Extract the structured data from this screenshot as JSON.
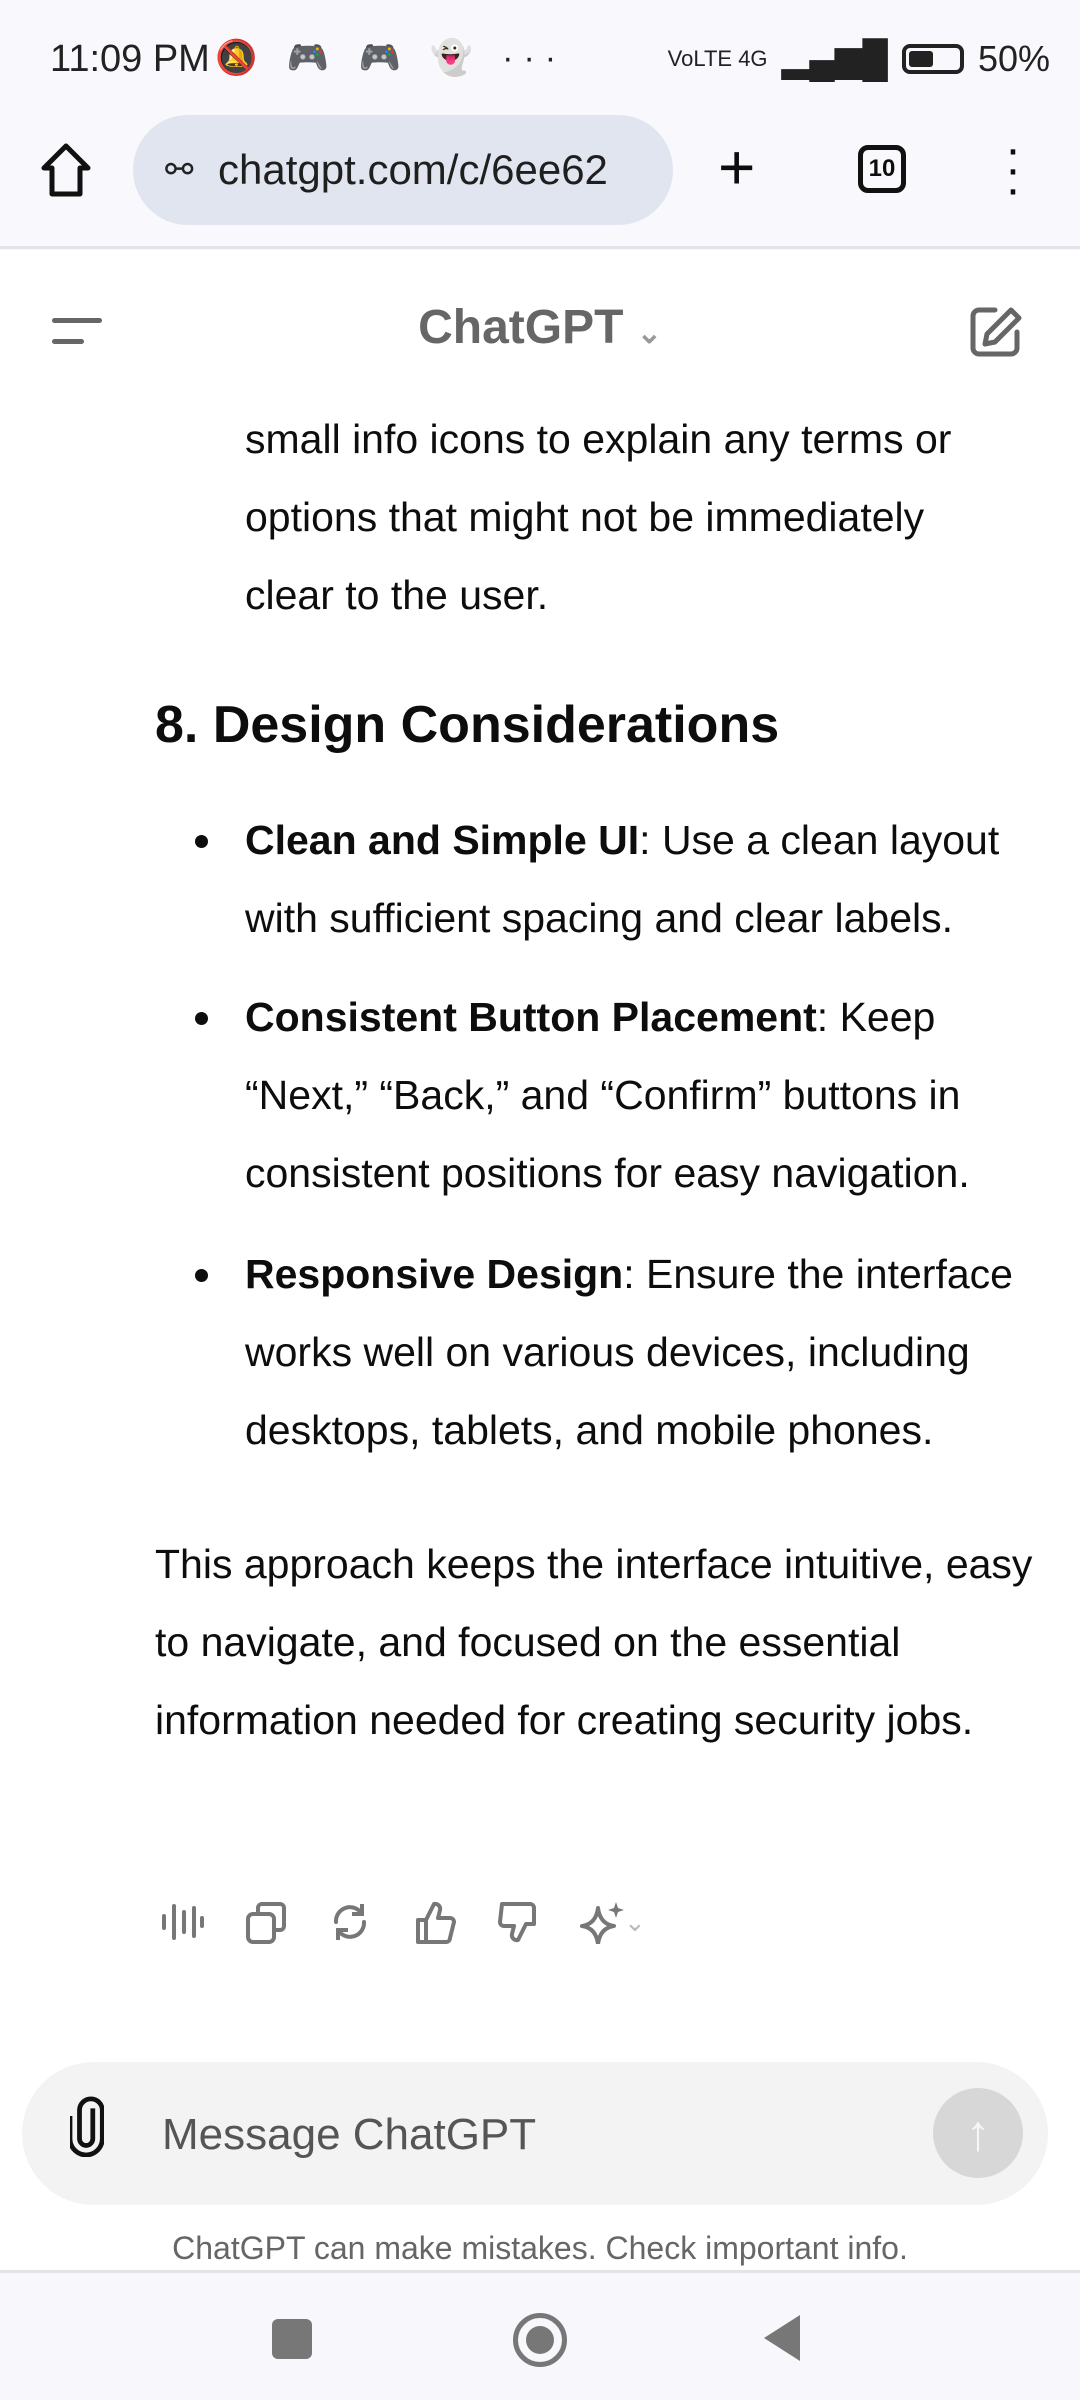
{
  "status_bar": {
    "time": "11:09 PM",
    "notification_icons": "🔕 🎮 🎮 👻 ···",
    "network": "VoLTE 4G",
    "battery": "50%",
    "battery_level": 50
  },
  "browser": {
    "url": "chatgpt.com/c/6ee62",
    "tab_count": "10"
  },
  "header": {
    "title": "ChatGPT"
  },
  "content": {
    "intro_lines": [
      "small info icons to explain any terms or",
      "options that might not be immediately",
      "clear to the user."
    ],
    "heading": "8. Design Considerations",
    "bullets": [
      {
        "bold": "Clean and Simple UI",
        "text": ": Use a clean layout with sufficient spacing and clear labels."
      },
      {
        "bold": "Consistent Button Placement",
        "text": ": Keep “Next,” “Back,” and “Confirm” buttons in consistent positions for easy navigation."
      },
      {
        "bold": "Responsive Design",
        "text": ": Ensure the interface works well on various devices, including desktops, tablets, and mobile phones."
      }
    ],
    "closing": "This approach keeps the interface intuitive, easy to navigate, and focused on the essential information needed for creating security jobs."
  },
  "composer": {
    "placeholder": "Message ChatGPT"
  },
  "footer": "ChatGPT can make mistakes. Check important info."
}
